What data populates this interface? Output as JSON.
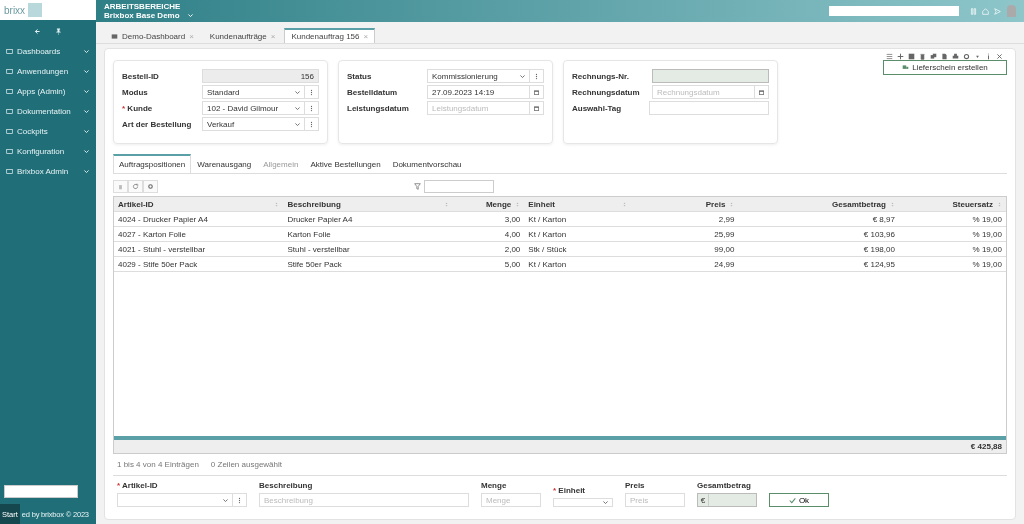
{
  "app": {
    "logo": "brixx",
    "workspace_label": "ARBEITSBEREICHE",
    "workspace": "Brixbox Base Demo"
  },
  "sidebar": {
    "items": [
      {
        "label": "Dashboards",
        "expanded": false
      },
      {
        "label": "Anwendungen",
        "expanded": false
      },
      {
        "label": "Apps (Admin)",
        "expanded": false
      },
      {
        "label": "Dokumentation",
        "expanded": false
      },
      {
        "label": "Cockpits",
        "expanded": false
      },
      {
        "label": "Konfiguration",
        "expanded": false
      },
      {
        "label": "Brixbox Admin",
        "expanded": false
      }
    ],
    "footer": "ed by brixbox © 2023",
    "start_button": "Start"
  },
  "tabs": [
    {
      "label": "Demo-Dashboard",
      "close": "×",
      "selected": false
    },
    {
      "label": "Kundenaufträge",
      "close": "×",
      "selected": false
    },
    {
      "label": "Kundenauftrag 156",
      "close": "×",
      "selected": true
    }
  ],
  "create_button": "Lieferschein erstellen",
  "form_cards": [
    {
      "fields": [
        {
          "label": "Bestell-ID",
          "kind": "readonly",
          "value": "156"
        },
        {
          "label": "Modus",
          "kind": "select",
          "value": "Standard"
        },
        {
          "label": "Kunde",
          "required_mark": "*",
          "kind": "select",
          "value": "102 - David Gilmour"
        },
        {
          "label": "Art der Bestellung",
          "kind": "select",
          "value": "Verkauf"
        }
      ]
    },
    {
      "fields": [
        {
          "label": "Status",
          "kind": "select",
          "value": "Kommissionierung"
        },
        {
          "label": "Bestelldatum",
          "kind": "date",
          "value": "27.09.2023 14:19"
        },
        {
          "label": "Leistungsdatum",
          "kind": "date",
          "placeholder": "Leistungsdatum"
        }
      ]
    },
    {
      "fields": [
        {
          "label": "Rechnungs-Nr.",
          "kind": "readonly"
        },
        {
          "label": "Rechnungsdatum",
          "kind": "date",
          "placeholder": "Rechnungsdatum"
        },
        {
          "label": "Auswahl-Tag",
          "kind": "text"
        }
      ]
    }
  ],
  "detail_tabs": [
    {
      "label": "Auftragspositionen",
      "selected": true,
      "disabled": false
    },
    {
      "label": "Warenausgang",
      "selected": false,
      "disabled": false
    },
    {
      "label": "Allgemein",
      "selected": false,
      "disabled": true
    },
    {
      "label": "Aktive Bestellungen",
      "selected": false,
      "disabled": false
    },
    {
      "label": "Dokumentvorschau",
      "selected": false,
      "disabled": false
    }
  ],
  "table": {
    "columns": [
      {
        "label": "Artikel-ID",
        "numeric": false
      },
      {
        "label": "Beschreibung",
        "numeric": false
      },
      {
        "label": "Menge",
        "numeric": true
      },
      {
        "label": "Einheit",
        "numeric": false
      },
      {
        "label": "Preis",
        "numeric": true
      },
      {
        "label": "Gesamtbetrag",
        "numeric": true
      },
      {
        "label": "Steuersatz",
        "numeric": true
      }
    ],
    "rows": [
      [
        "4024 - Drucker Papier A4",
        "Drucker Papier A4",
        "3,00",
        "Kt / Karton",
        "2,99",
        "€ 8,97",
        "% 19,00"
      ],
      [
        "4027 - Karton Folie",
        "Karton Folie",
        "4,00",
        "Kt / Karton",
        "25,99",
        "€ 103,96",
        "% 19,00"
      ],
      [
        "4021 - Stuhl - verstellbar",
        "Stuhl - verstellbar",
        "2,00",
        "Stk / Stück",
        "99,00",
        "€ 198,00",
        "% 19,00"
      ],
      [
        "4029 - Stife 50er Pack",
        "Stife 50er Pack",
        "5,00",
        "Kt / Karton",
        "24,99",
        "€ 124,95",
        "% 19,00"
      ]
    ],
    "total": "€ 425,88"
  },
  "status": {
    "range": "1 bis 4 von 4 Einträgen",
    "selection": "0 Zeilen ausgewählt"
  },
  "entry_form": {
    "fields": [
      {
        "label": "Artikel-ID",
        "required_mark": "*",
        "kind": "select"
      },
      {
        "label": "Beschreibung",
        "kind": "text",
        "placeholder": "Beschreibung"
      },
      {
        "label": "Menge",
        "kind": "text",
        "placeholder": "Menge"
      },
      {
        "label": "Einheit",
        "required_mark": "*",
        "kind": "select-plain"
      },
      {
        "label": "Preis",
        "kind": "text",
        "placeholder": "Preis"
      },
      {
        "label": "Gesamtbetrag",
        "kind": "currency",
        "prefix": "€"
      }
    ],
    "ok_button": "Ok"
  }
}
